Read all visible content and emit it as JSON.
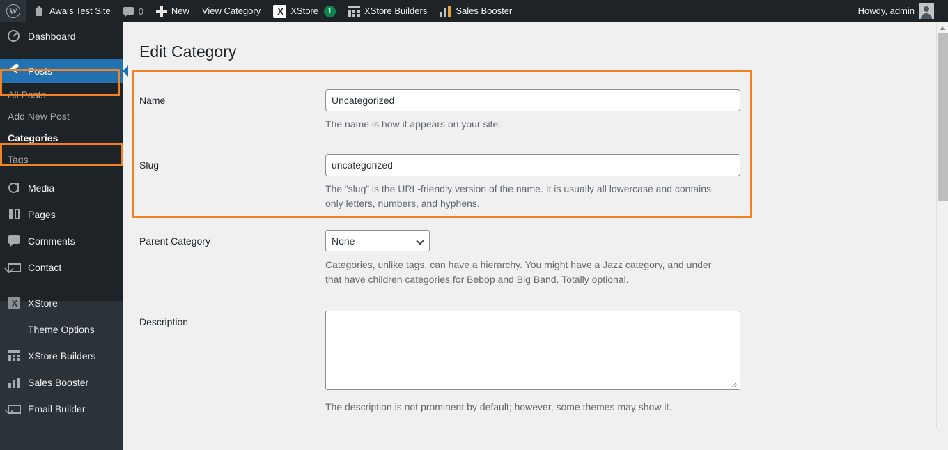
{
  "adminbar": {
    "wp_logo": "wordpress-logo",
    "site_name": "Awais Test Site",
    "comment_count": "0",
    "new_label": "New",
    "view_category_label": "View Category",
    "xstore_label": "XStore",
    "xstore_badge": "1",
    "xstore_glyph": "X",
    "xstore_builders_label": "XStore Builders",
    "sales_booster_label": "Sales Booster",
    "howdy": "Howdy, admin"
  },
  "sidebar": {
    "items": [
      {
        "label": "Dashboard",
        "icon": "dashboard-icon"
      },
      {
        "label": "Posts",
        "icon": "pin-icon"
      },
      {
        "label": "Media",
        "icon": "media-icon"
      },
      {
        "label": "Pages",
        "icon": "pages-icon"
      },
      {
        "label": "Comments",
        "icon": "comment-icon"
      },
      {
        "label": "Contact",
        "icon": "mail-icon"
      },
      {
        "label": "XStore",
        "icon": "xstore-icon"
      },
      {
        "label": "Theme Options",
        "icon": "sliders-icon"
      },
      {
        "label": "XStore Builders",
        "icon": "grid-icon"
      },
      {
        "label": "Sales Booster",
        "icon": "bar-chart-icon"
      },
      {
        "label": "Email Builder",
        "icon": "envelope-icon"
      }
    ],
    "submenu": [
      {
        "label": "All Posts",
        "current": false
      },
      {
        "label": "Add New Post",
        "current": false
      },
      {
        "label": "Categories",
        "current": true
      },
      {
        "label": "Tags",
        "current": false
      }
    ],
    "xstore_glyph": "X"
  },
  "main": {
    "page_title": "Edit Category",
    "fields": {
      "name": {
        "label": "Name",
        "value": "Uncategorized",
        "help": "The name is how it appears on your site."
      },
      "slug": {
        "label": "Slug",
        "value": "uncategorized",
        "help": "The “slug” is the URL-friendly version of the name. It is usually all lowercase and contains only letters, numbers, and hyphens."
      },
      "parent": {
        "label": "Parent Category",
        "value": "None",
        "help": "Categories, unlike tags, can have a hierarchy. You might have a Jazz category, and under that have children categories for Bebop and Big Band. Totally optional."
      },
      "description": {
        "label": "Description",
        "value": "",
        "help": "The description is not prominent by default; however, some themes may show it."
      }
    }
  },
  "colors": {
    "highlight": "#f58220",
    "admin_blue": "#2271b1",
    "sidebar_dark": "#1d2327",
    "sidebar_light": "#2c3338",
    "badge_green": "#0f834d"
  }
}
